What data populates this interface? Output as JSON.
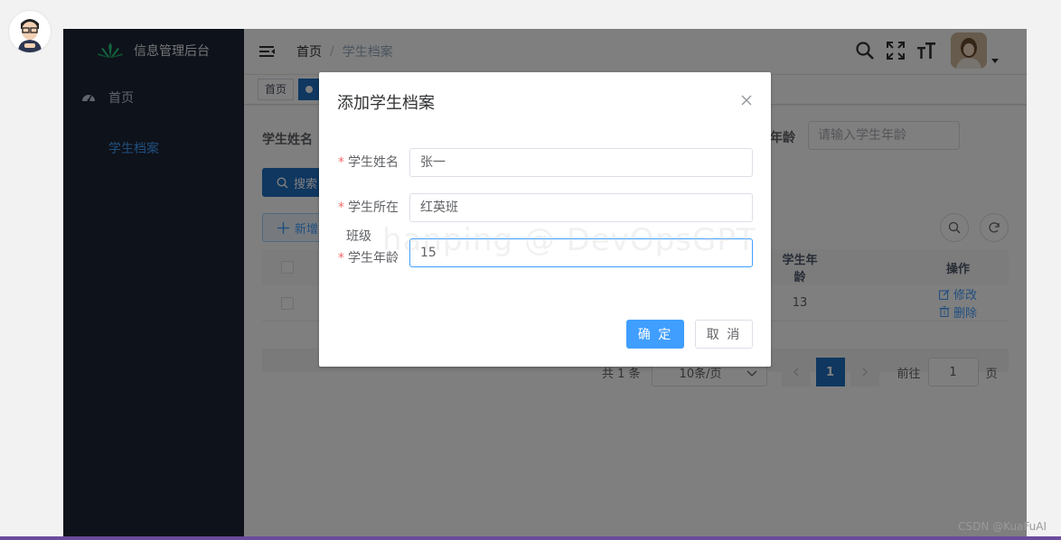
{
  "sidebar": {
    "logo_text": "信息管理后台",
    "items": [
      {
        "label": "首页"
      },
      {
        "label": "学生档案"
      }
    ]
  },
  "navbar": {
    "breadcrumb": {
      "home": "首页",
      "separator": "/",
      "current": "学生档案"
    }
  },
  "tags": {
    "home": "首页"
  },
  "search": {
    "name_label": "学生姓名",
    "age_label": "年龄",
    "age_placeholder": "请输入学生年龄",
    "search_button": "搜索",
    "add_button": "新增"
  },
  "table": {
    "headers": {
      "age": "学生年龄",
      "operation": "操作"
    },
    "rows": [
      {
        "age": "13",
        "edit": "修改",
        "delete": "删除"
      }
    ]
  },
  "pagination": {
    "total": "共 1 条",
    "page_size": "10条/页",
    "current_page": "1",
    "goto_label": "前往",
    "goto_value": "1",
    "goto_suffix": "页"
  },
  "dialog": {
    "title": "添加学生档案",
    "fields": [
      {
        "label": "学生姓名",
        "value": "张一",
        "required": "*"
      },
      {
        "label": "学生所在",
        "value": "红英班",
        "required": "*"
      },
      {
        "label": "学生年龄",
        "value": "15",
        "required": "*"
      }
    ],
    "wrap_label": "班级",
    "confirm": "确 定",
    "cancel": "取 消"
  },
  "watermark": "hanping @ DevOpsGPT",
  "csdn": "CSDN @KuaFuAI",
  "colors": {
    "sidebar_bg": "#1d2434",
    "primary": "#409eff",
    "primary_dark": "#1f6fc0",
    "required": "#f56c6c"
  }
}
